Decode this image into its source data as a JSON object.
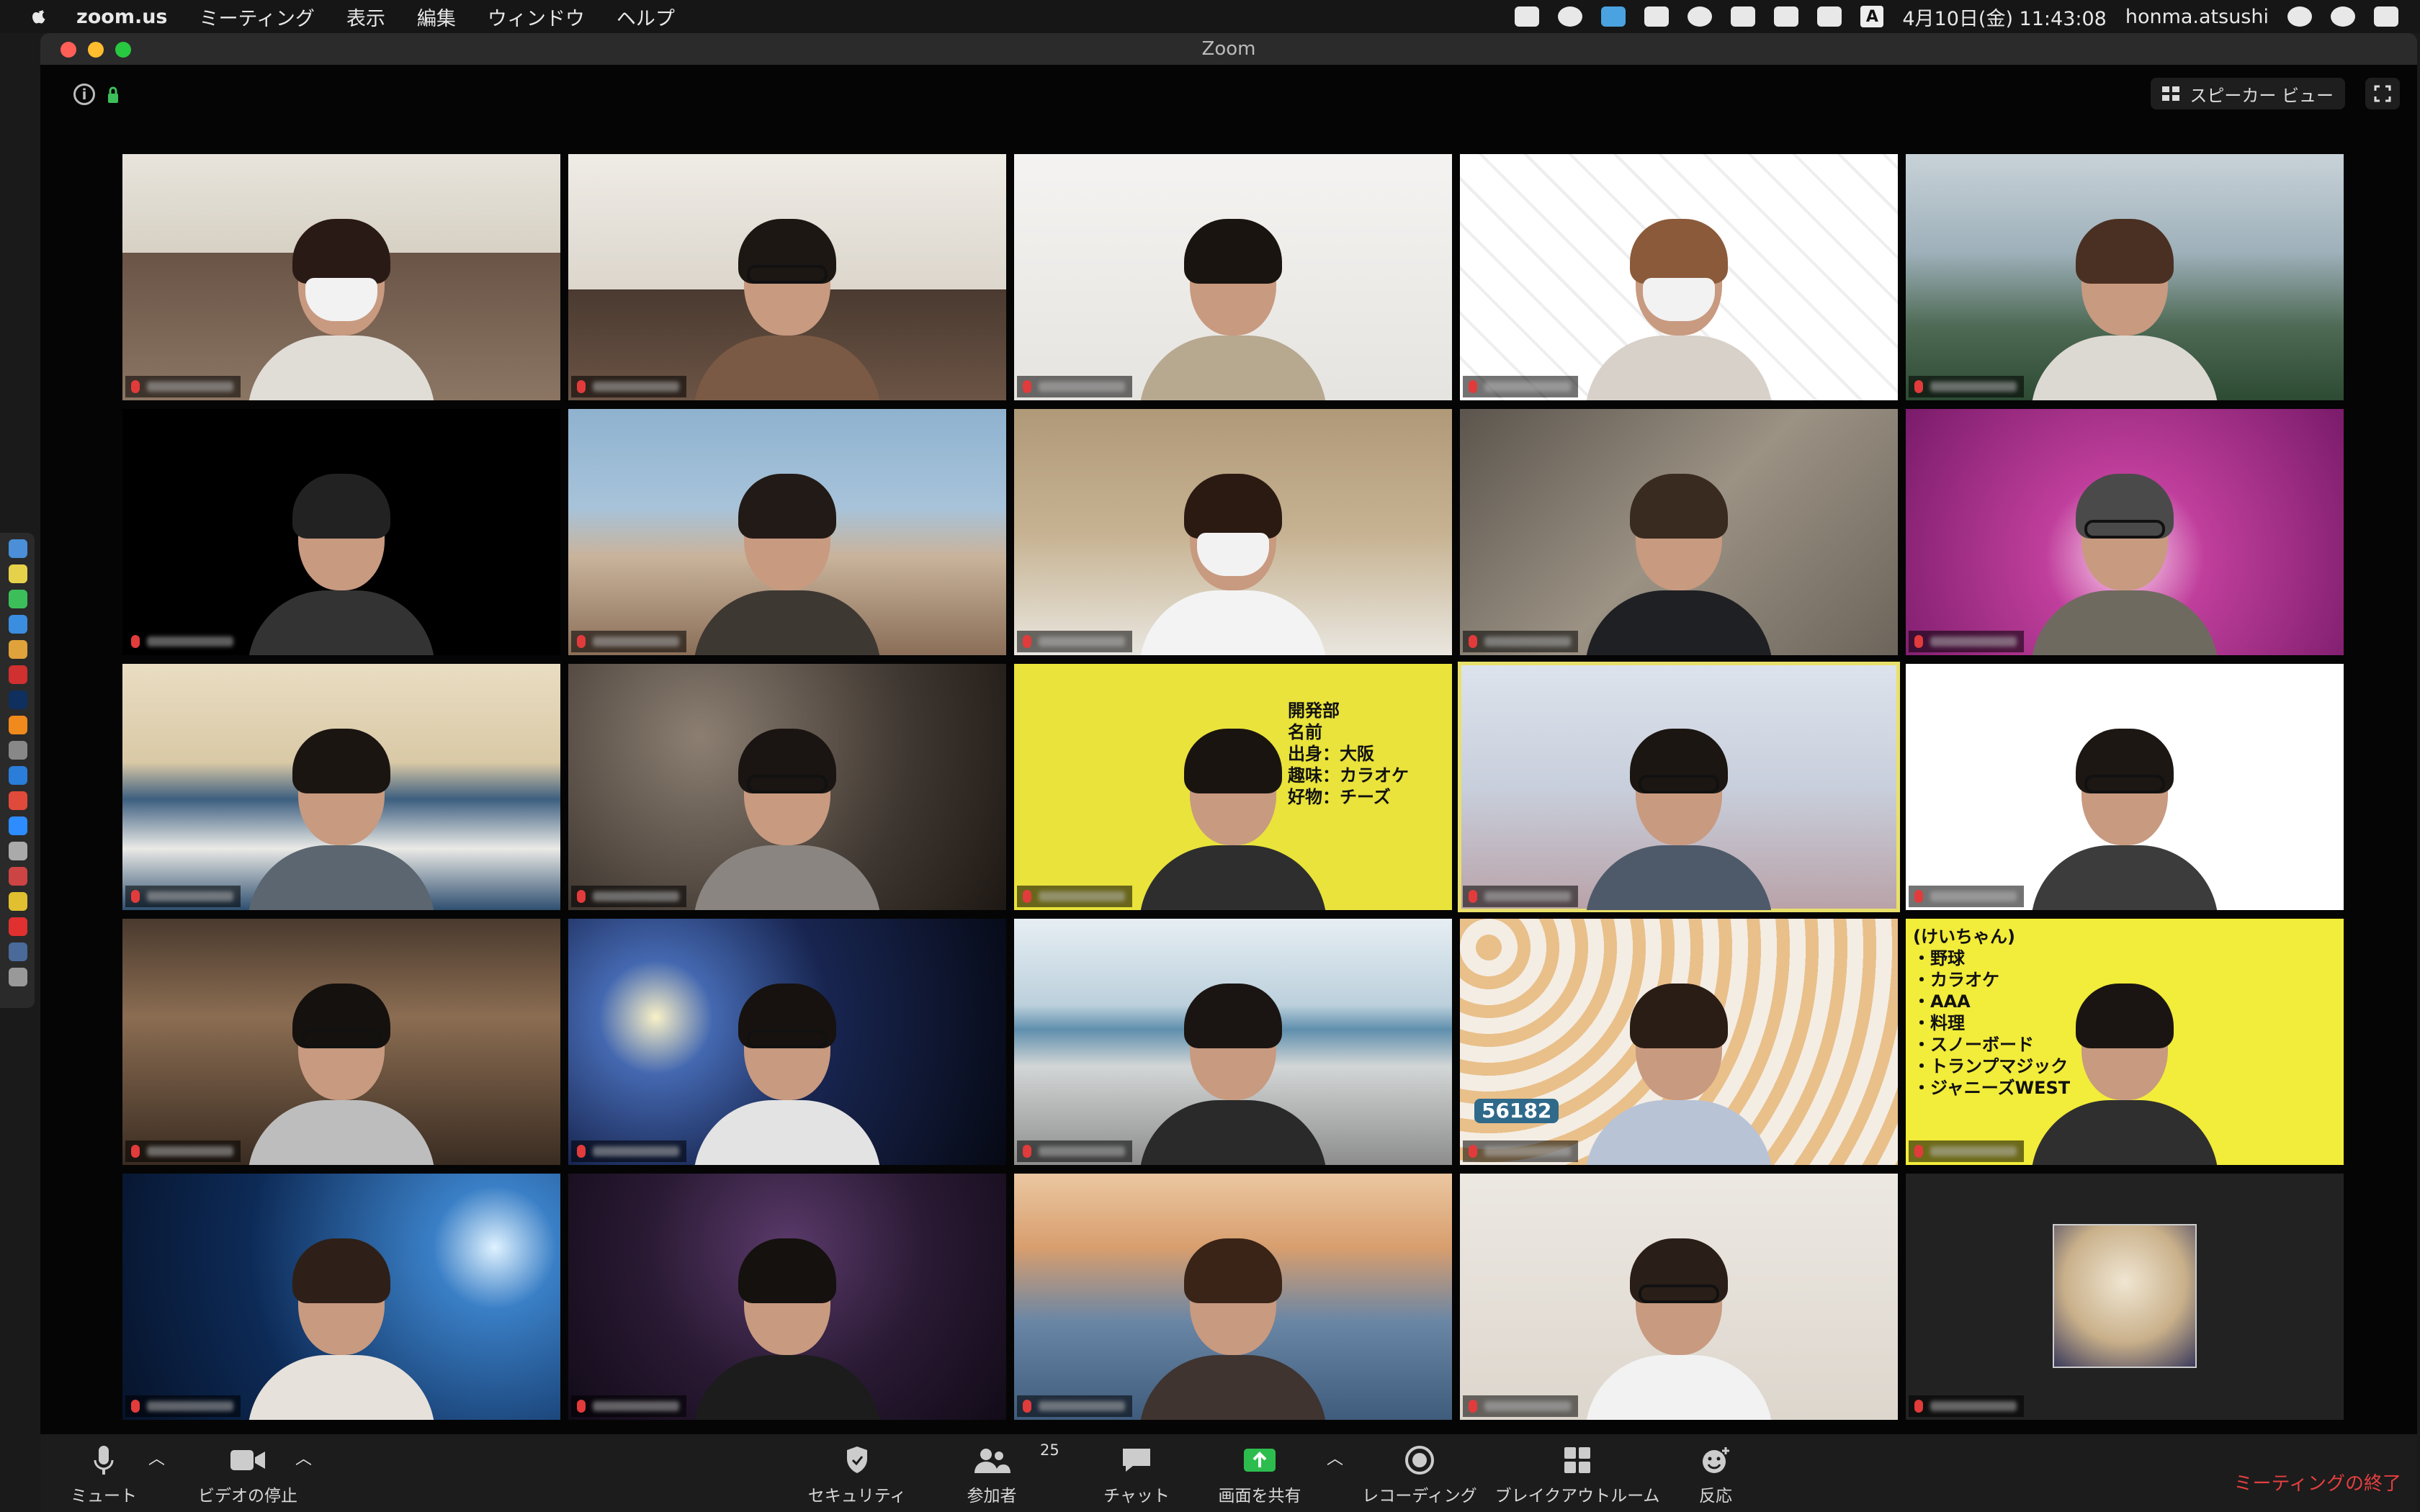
{
  "menubar": {
    "app": "zoom.us",
    "items": [
      "ミーティング",
      "表示",
      "編集",
      "ウィンドウ",
      "ヘルプ"
    ],
    "input_mode": "A",
    "datetime": "4月10日(金)  11:43:08",
    "user": "honma.atsushi"
  },
  "window": {
    "title": "Zoom",
    "speaker_view_label": "スピーカー ビュー"
  },
  "tiles": [
    {
      "bg": "bg-room1",
      "mask": true,
      "hair": "#2a1a15",
      "body": "#e0ddd7"
    },
    {
      "bg": "bg-office",
      "glasses": true,
      "hair": "#1d1714",
      "body": "#7b5a45"
    },
    {
      "bg": "bg-plain",
      "hair": "#1a1411",
      "body": "#b7a890"
    },
    {
      "bg": "bg-cats",
      "mask": true,
      "hair": "#8a5a3a",
      "body": "#d8d1c9"
    },
    {
      "bg": "bg-coast",
      "hair": "#4a3022",
      "body": "#dcd8d2"
    },
    {
      "bg": "bg-game",
      "hair": "#222",
      "body": "#333"
    },
    {
      "bg": "bg-room2",
      "hair": "#221a16",
      "body": "#3e3833"
    },
    {
      "bg": "bg-wall",
      "mask": true,
      "hair": "#2a1a12",
      "body": "#f3f3f3"
    },
    {
      "bg": "bg-plaster",
      "hair": "#3a2b20",
      "body": "#1f2024"
    },
    {
      "bg": "bg-purple",
      "glasses": true,
      "hair": "#4a4a4a",
      "body": "#6f6a60"
    },
    {
      "bg": "bg-wave",
      "hair": "#1b1512",
      "body": "#5b6670"
    },
    {
      "bg": "bg-catphoto",
      "glasses": true,
      "hair": "#1a1512",
      "body": "#8a8580"
    },
    {
      "bg": "bg-yellow",
      "hair": "#1a1411",
      "body": "#2e2e2e"
    },
    {
      "bg": "bg-blossom",
      "glasses": true,
      "hair": "#1c1612",
      "body": "#4e5a6a",
      "active": true
    },
    {
      "bg": "bg-qr",
      "glasses": true,
      "hair": "#1d1713",
      "body": "#3c3c3c"
    },
    {
      "bg": "bg-living",
      "glasses": true,
      "hair": "#15110e",
      "body": "#bdbdbd"
    },
    {
      "bg": "bg-space",
      "glasses": true,
      "hair": "#17120f",
      "body": "#e3e3e3"
    },
    {
      "bg": "bg-sea",
      "hair": "#1a1512",
      "body": "#2a2a2a"
    },
    {
      "bg": "bg-bread",
      "hair": "#2a1d15",
      "body": "#b9c3d6"
    },
    {
      "bg": "bg-yellow2",
      "hair": "#1a1512",
      "body": "#2f2f2f"
    },
    {
      "bg": "bg-stage",
      "hair": "#2e2018",
      "body": "#e6e1db"
    },
    {
      "bg": "bg-club",
      "hair": "#15110e",
      "body": "#1c1c1c"
    },
    {
      "bg": "bg-bridge",
      "hair": "#3a2418",
      "body": "#3f3430"
    },
    {
      "bg": "bg-bareroom",
      "glasses": true,
      "hair": "#2a1f18",
      "body": "#f2f2f2"
    },
    {
      "bg": "bg-dark",
      "avatar": true
    }
  ],
  "overlays": {
    "dev_card": {
      "title": "開発部",
      "lines": [
        "名前 ",
        "出身：大阪",
        "趣味：カラオケ",
        "好物：チーズ"
      ]
    },
    "bread_number": "56182",
    "hobby_card": {
      "title": "(けいちゃん)",
      "lines": [
        "・野球",
        "・カラオケ",
        "・AAA",
        "・料理",
        "・スノーボード",
        "・トランプマジック",
        "・ジャニーズWEST"
      ]
    }
  },
  "toolbar": {
    "mute": "ミュート",
    "stop_video": "ビデオの停止",
    "security": "セキュリティ",
    "participants": "参加者",
    "participants_count": "25",
    "chat": "チャット",
    "share": "画面を共有",
    "record": "レコーディング",
    "breakout": "ブレイクアウトルーム",
    "reactions": "反応",
    "end": "ミーティングの終了"
  },
  "colors": {
    "end_meeting": "#e53f3f",
    "share_green": "#2dbd4e",
    "active_speaker": "#e8e06a"
  }
}
